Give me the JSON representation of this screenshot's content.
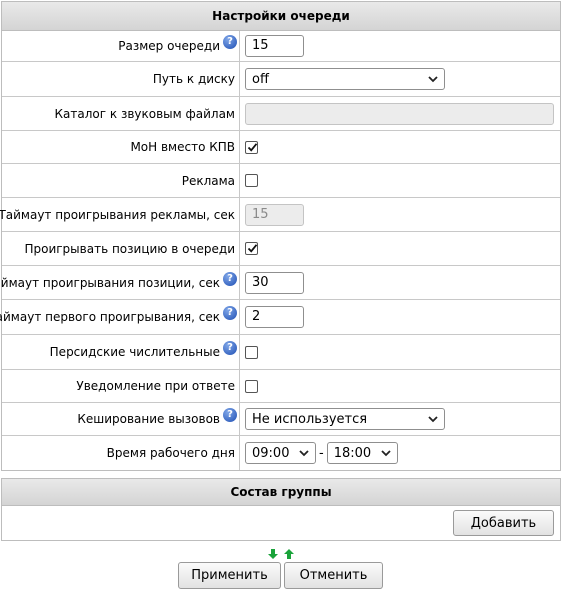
{
  "queue_settings": {
    "title": "Настройки очереди",
    "queue_size": {
      "label": "Размер очереди",
      "value": "15"
    },
    "disk_path": {
      "label": "Путь к диску",
      "value": "off"
    },
    "sound_dir": {
      "label": "Каталог к звуковым файлам",
      "value": ""
    },
    "moh": {
      "label": "MoH вместо КПВ",
      "checked": true
    },
    "advert": {
      "label": "Реклама",
      "checked": false
    },
    "advert_timeout": {
      "label": "Таймаут проигрывания рекламы, сек",
      "value": "15"
    },
    "play_position": {
      "label": "Проигрывать позицию в очереди",
      "checked": true
    },
    "position_timeout": {
      "label": "Таймаут проигрывания позиции, сек",
      "value": "30"
    },
    "first_play_timeout": {
      "label": "Таймаут первого проигрывания, сек",
      "value": "2"
    },
    "persian_numerals": {
      "label": "Персидские числительные",
      "checked": false
    },
    "answer_notify": {
      "label": "Уведомление при ответе",
      "checked": false
    },
    "call_caching": {
      "label": "Кеширование вызовов",
      "value": "Не используется"
    },
    "work_hours": {
      "label": "Время рабочего дня",
      "from": "09:00",
      "separator": "-",
      "to": "18:00"
    }
  },
  "group": {
    "title": "Состав группы",
    "add_label": "Добавить"
  },
  "footer": {
    "apply_label": "Применить",
    "cancel_label": "Отменить"
  },
  "colors": {
    "header_bg": "#dcdcdc",
    "help_icon": "#2a5fc1",
    "arrow_green": "#1aa33a"
  },
  "icons": [
    "help-icon",
    "chevron-down-icon",
    "checkmark-icon",
    "arrow-down-icon",
    "arrow-up-icon"
  ]
}
